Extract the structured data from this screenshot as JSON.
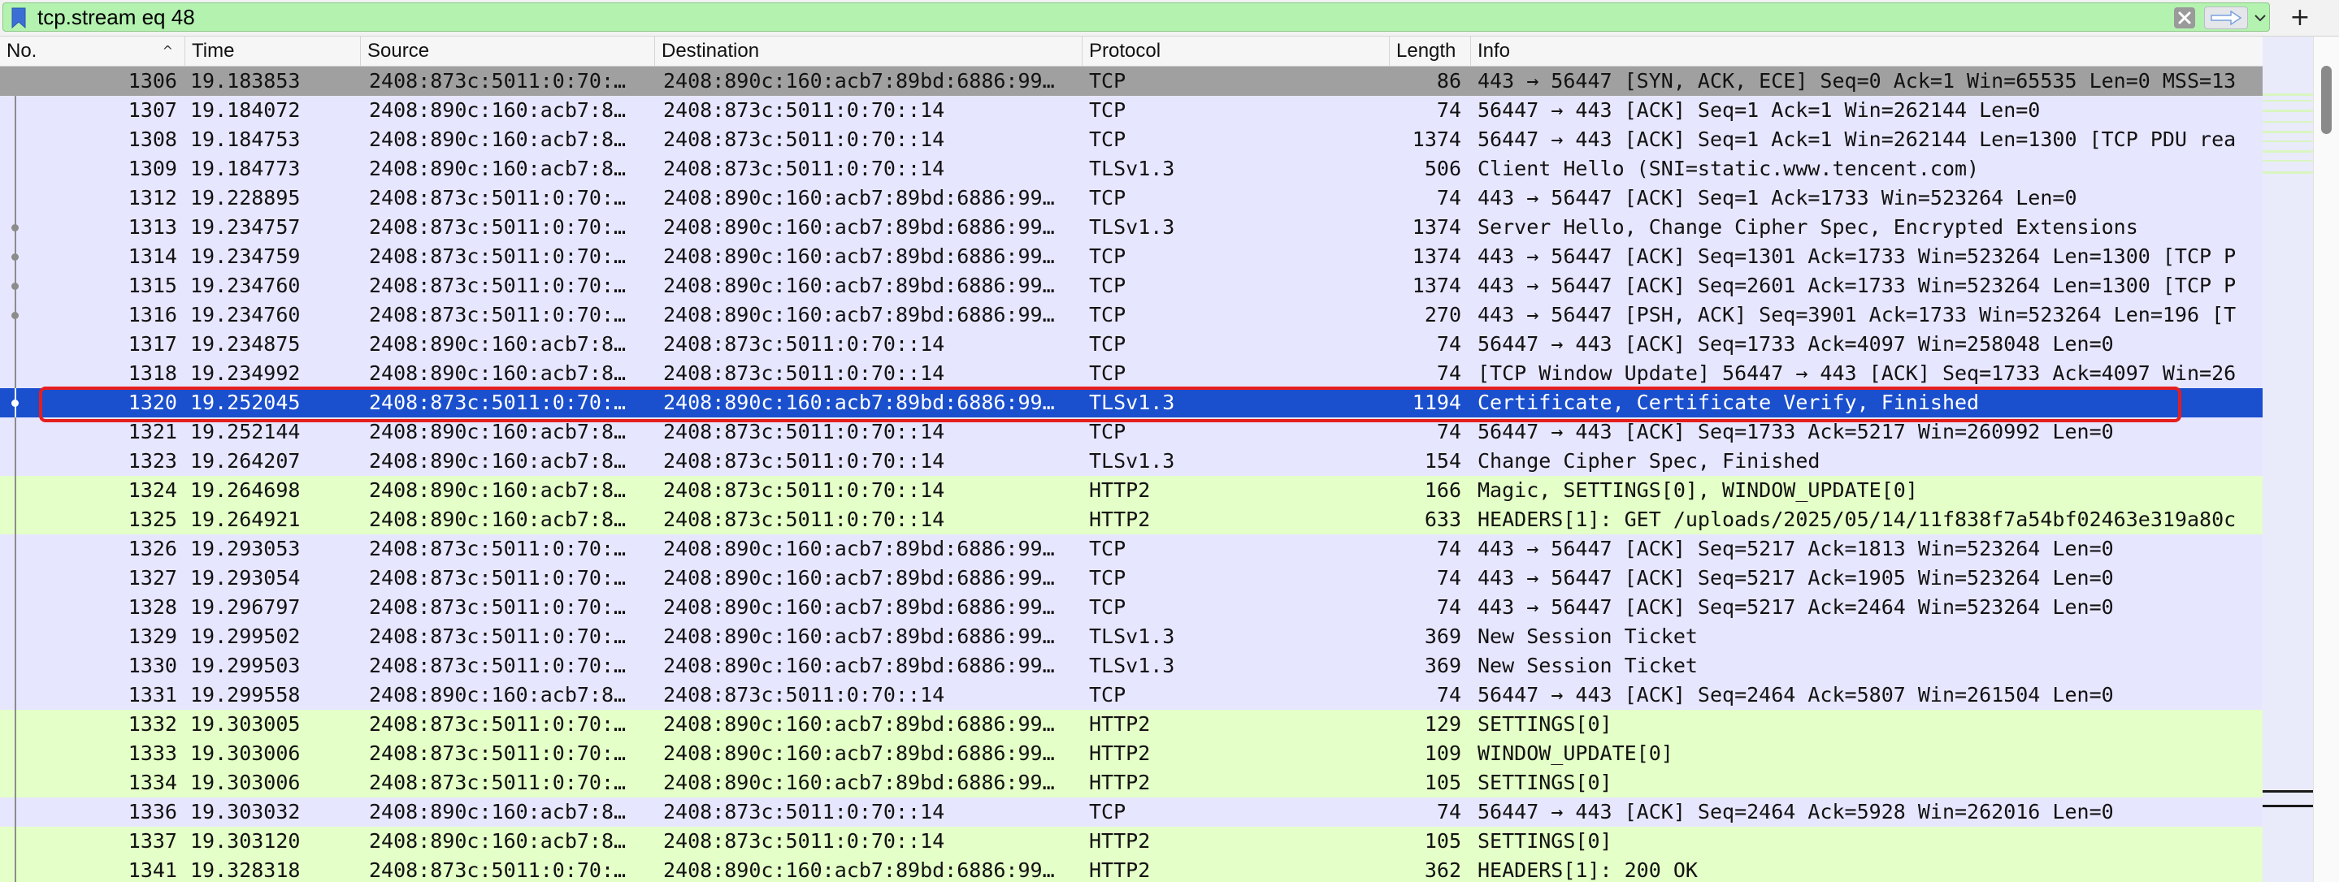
{
  "filter": {
    "value": "tcp.stream eq 48",
    "bg_color": "#b4f2b0"
  },
  "toolbar_icons": {
    "bookmark": "bookmark-icon",
    "clear": "clear-filter-icon",
    "apply": "apply-arrow-icon",
    "dropdown": "chevron-down-icon",
    "add": "plus-icon",
    "add_label": "+"
  },
  "columns": {
    "no": "No.",
    "time": "Time",
    "source": "Source",
    "destination": "Destination",
    "protocol": "Protocol",
    "length": "Length",
    "info": "Info",
    "sort_indicator": "^"
  },
  "colors": {
    "tcp_row": "#e7e6ff",
    "http2_row": "#e4ffc7",
    "syn_row": "#a0a0a0",
    "selected_row": "#1a4fce",
    "selection_outline": "#e51e1e"
  },
  "packets": [
    {
      "no": "1306",
      "time": "19.183853",
      "src": "2408:873c:5011:0:70:…",
      "dst": "2408:890c:160:acb7:89bd:6886:99…",
      "proto": "TCP",
      "len": "86",
      "info": "443 → 56447 [SYN, ACK, ECE] Seq=0 Ack=1 Win=65535 Len=0 MSS=13",
      "kind": "syn"
    },
    {
      "no": "1307",
      "time": "19.184072",
      "src": "2408:890c:160:acb7:8…",
      "dst": "2408:873c:5011:0:70::14",
      "proto": "TCP",
      "len": "74",
      "info": "56447 → 443 [ACK] Seq=1 Ack=1 Win=262144 Len=0",
      "kind": "tcp"
    },
    {
      "no": "1308",
      "time": "19.184753",
      "src": "2408:890c:160:acb7:8…",
      "dst": "2408:873c:5011:0:70::14",
      "proto": "TCP",
      "len": "1374",
      "info": "56447 → 443 [ACK] Seq=1 Ack=1 Win=262144 Len=1300 [TCP PDU rea",
      "kind": "tcp"
    },
    {
      "no": "1309",
      "time": "19.184773",
      "src": "2408:890c:160:acb7:8…",
      "dst": "2408:873c:5011:0:70::14",
      "proto": "TLSv1.3",
      "len": "506",
      "info": "Client Hello (SNI=static.www.tencent.com)",
      "kind": "tcp"
    },
    {
      "no": "1312",
      "time": "19.228895",
      "src": "2408:873c:5011:0:70:…",
      "dst": "2408:890c:160:acb7:89bd:6886:99…",
      "proto": "TCP",
      "len": "74",
      "info": "443 → 56447 [ACK] Seq=1 Ack=1733 Win=523264 Len=0",
      "kind": "tcp"
    },
    {
      "no": "1313",
      "time": "19.234757",
      "src": "2408:873c:5011:0:70:…",
      "dst": "2408:890c:160:acb7:89bd:6886:99…",
      "proto": "TLSv1.3",
      "len": "1374",
      "info": "Server Hello, Change Cipher Spec, Encrypted Extensions",
      "kind": "tcp"
    },
    {
      "no": "1314",
      "time": "19.234759",
      "src": "2408:873c:5011:0:70:…",
      "dst": "2408:890c:160:acb7:89bd:6886:99…",
      "proto": "TCP",
      "len": "1374",
      "info": "443 → 56447 [ACK] Seq=1301 Ack=1733 Win=523264 Len=1300 [TCP P",
      "kind": "tcp"
    },
    {
      "no": "1315",
      "time": "19.234760",
      "src": "2408:873c:5011:0:70:…",
      "dst": "2408:890c:160:acb7:89bd:6886:99…",
      "proto": "TCP",
      "len": "1374",
      "info": "443 → 56447 [ACK] Seq=2601 Ack=1733 Win=523264 Len=1300 [TCP P",
      "kind": "tcp"
    },
    {
      "no": "1316",
      "time": "19.234760",
      "src": "2408:873c:5011:0:70:…",
      "dst": "2408:890c:160:acb7:89bd:6886:99…",
      "proto": "TCP",
      "len": "270",
      "info": "443 → 56447 [PSH, ACK] Seq=3901 Ack=1733 Win=523264 Len=196 [T",
      "kind": "tcp"
    },
    {
      "no": "1317",
      "time": "19.234875",
      "src": "2408:890c:160:acb7:8…",
      "dst": "2408:873c:5011:0:70::14",
      "proto": "TCP",
      "len": "74",
      "info": "56447 → 443 [ACK] Seq=1733 Ack=4097 Win=258048 Len=0",
      "kind": "tcp"
    },
    {
      "no": "1318",
      "time": "19.234992",
      "src": "2408:890c:160:acb7:8…",
      "dst": "2408:873c:5011:0:70::14",
      "proto": "TCP",
      "len": "74",
      "info": "[TCP Window Update] 56447 → 443 [ACK] Seq=1733 Ack=4097 Win=26",
      "kind": "tcp"
    },
    {
      "no": "1320",
      "time": "19.252045",
      "src": "2408:873c:5011:0:70:…",
      "dst": "2408:890c:160:acb7:89bd:6886:99…",
      "proto": "TLSv1.3",
      "len": "1194",
      "info": "Certificate, Certificate Verify, Finished",
      "kind": "selected"
    },
    {
      "no": "1321",
      "time": "19.252144",
      "src": "2408:890c:160:acb7:8…",
      "dst": "2408:873c:5011:0:70::14",
      "proto": "TCP",
      "len": "74",
      "info": "56447 → 443 [ACK] Seq=1733 Ack=5217 Win=260992 Len=0",
      "kind": "tcp"
    },
    {
      "no": "1323",
      "time": "19.264207",
      "src": "2408:890c:160:acb7:8…",
      "dst": "2408:873c:5011:0:70::14",
      "proto": "TLSv1.3",
      "len": "154",
      "info": "Change Cipher Spec, Finished",
      "kind": "tcp"
    },
    {
      "no": "1324",
      "time": "19.264698",
      "src": "2408:890c:160:acb7:8…",
      "dst": "2408:873c:5011:0:70::14",
      "proto": "HTTP2",
      "len": "166",
      "info": "Magic, SETTINGS[0], WINDOW_UPDATE[0]",
      "kind": "http2"
    },
    {
      "no": "1325",
      "time": "19.264921",
      "src": "2408:890c:160:acb7:8…",
      "dst": "2408:873c:5011:0:70::14",
      "proto": "HTTP2",
      "len": "633",
      "info": "HEADERS[1]: GET /uploads/2025/05/14/11f838f7a54bf02463e319a80c",
      "kind": "http2"
    },
    {
      "no": "1326",
      "time": "19.293053",
      "src": "2408:873c:5011:0:70:…",
      "dst": "2408:890c:160:acb7:89bd:6886:99…",
      "proto": "TCP",
      "len": "74",
      "info": "443 → 56447 [ACK] Seq=5217 Ack=1813 Win=523264 Len=0",
      "kind": "tcp"
    },
    {
      "no": "1327",
      "time": "19.293054",
      "src": "2408:873c:5011:0:70:…",
      "dst": "2408:890c:160:acb7:89bd:6886:99…",
      "proto": "TCP",
      "len": "74",
      "info": "443 → 56447 [ACK] Seq=5217 Ack=1905 Win=523264 Len=0",
      "kind": "tcp"
    },
    {
      "no": "1328",
      "time": "19.296797",
      "src": "2408:873c:5011:0:70:…",
      "dst": "2408:890c:160:acb7:89bd:6886:99…",
      "proto": "TCP",
      "len": "74",
      "info": "443 → 56447 [ACK] Seq=5217 Ack=2464 Win=523264 Len=0",
      "kind": "tcp"
    },
    {
      "no": "1329",
      "time": "19.299502",
      "src": "2408:873c:5011:0:70:…",
      "dst": "2408:890c:160:acb7:89bd:6886:99…",
      "proto": "TLSv1.3",
      "len": "369",
      "info": "New Session Ticket",
      "kind": "tcp"
    },
    {
      "no": "1330",
      "time": "19.299503",
      "src": "2408:873c:5011:0:70:…",
      "dst": "2408:890c:160:acb7:89bd:6886:99…",
      "proto": "TLSv1.3",
      "len": "369",
      "info": "New Session Ticket",
      "kind": "tcp"
    },
    {
      "no": "1331",
      "time": "19.299558",
      "src": "2408:890c:160:acb7:8…",
      "dst": "2408:873c:5011:0:70::14",
      "proto": "TCP",
      "len": "74",
      "info": "56447 → 443 [ACK] Seq=2464 Ack=5807 Win=261504 Len=0",
      "kind": "tcp"
    },
    {
      "no": "1332",
      "time": "19.303005",
      "src": "2408:873c:5011:0:70:…",
      "dst": "2408:890c:160:acb7:89bd:6886:99…",
      "proto": "HTTP2",
      "len": "129",
      "info": "SETTINGS[0]",
      "kind": "http2"
    },
    {
      "no": "1333",
      "time": "19.303006",
      "src": "2408:873c:5011:0:70:…",
      "dst": "2408:890c:160:acb7:89bd:6886:99…",
      "proto": "HTTP2",
      "len": "109",
      "info": "WINDOW_UPDATE[0]",
      "kind": "http2"
    },
    {
      "no": "1334",
      "time": "19.303006",
      "src": "2408:873c:5011:0:70:…",
      "dst": "2408:890c:160:acb7:89bd:6886:99…",
      "proto": "HTTP2",
      "len": "105",
      "info": "SETTINGS[0]",
      "kind": "http2"
    },
    {
      "no": "1336",
      "time": "19.303032",
      "src": "2408:890c:160:acb7:8…",
      "dst": "2408:873c:5011:0:70::14",
      "proto": "TCP",
      "len": "74",
      "info": "56447 → 443 [ACK] Seq=2464 Ack=5928 Win=262016 Len=0",
      "kind": "tcp"
    },
    {
      "no": "1337",
      "time": "19.303120",
      "src": "2408:890c:160:acb7:8…",
      "dst": "2408:873c:5011:0:70::14",
      "proto": "HTTP2",
      "len": "105",
      "info": "SETTINGS[0]",
      "kind": "http2"
    },
    {
      "no": "1341",
      "time": "19.328318",
      "src": "2408:873c:5011:0:70:…",
      "dst": "2408:890c:160:acb7:89bd:6886:99…",
      "proto": "HTTP2",
      "len": "362",
      "info": "HEADERS[1]: 200 OK",
      "kind": "http2"
    }
  ]
}
